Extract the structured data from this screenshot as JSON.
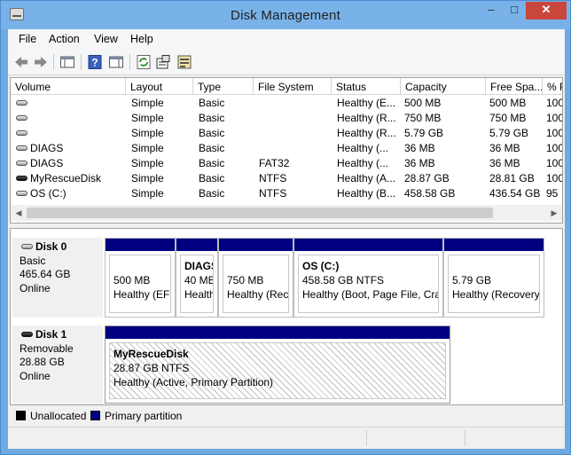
{
  "window": {
    "title": "Disk Management"
  },
  "menu": [
    "File",
    "Action",
    "View",
    "Help"
  ],
  "toolbar_icons": [
    "back-arrow-icon",
    "forward-arrow-icon",
    "console-tree-icon",
    "help-icon",
    "properties-panel-icon",
    "refresh-icon",
    "properties-icon",
    "export-list-icon"
  ],
  "volumes": {
    "columns": [
      "Volume",
      "Layout",
      "Type",
      "File System",
      "Status",
      "Capacity",
      "Free Spa...",
      "% F"
    ],
    "rows": [
      {
        "volume": "",
        "layout": "Simple",
        "type": "Basic",
        "fs": "",
        "status": "Healthy (E...",
        "capacity": "500 MB",
        "free": "500 MB",
        "pct": "100",
        "icon": "light"
      },
      {
        "volume": "",
        "layout": "Simple",
        "type": "Basic",
        "fs": "",
        "status": "Healthy (R...",
        "capacity": "750 MB",
        "free": "750 MB",
        "pct": "100",
        "icon": "light"
      },
      {
        "volume": "",
        "layout": "Simple",
        "type": "Basic",
        "fs": "",
        "status": "Healthy (R...",
        "capacity": "5.79 GB",
        "free": "5.79 GB",
        "pct": "100",
        "icon": "light"
      },
      {
        "volume": "DIAGS",
        "layout": "Simple",
        "type": "Basic",
        "fs": "",
        "status": "Healthy (...",
        "capacity": "36 MB",
        "free": "36 MB",
        "pct": "100",
        "icon": "light"
      },
      {
        "volume": "DIAGS",
        "layout": "Simple",
        "type": "Basic",
        "fs": "FAT32",
        "status": "Healthy (...",
        "capacity": "36 MB",
        "free": "36 MB",
        "pct": "100",
        "icon": "light"
      },
      {
        "volume": "MyRescueDisk",
        "layout": "Simple",
        "type": "Basic",
        "fs": "NTFS",
        "status": "Healthy (A...",
        "capacity": "28.87 GB",
        "free": "28.81 GB",
        "pct": "100",
        "icon": "dark"
      },
      {
        "volume": "OS (C:)",
        "layout": "Simple",
        "type": "Basic",
        "fs": "NTFS",
        "status": "Healthy (B...",
        "capacity": "458.58 GB",
        "free": "436.54 GB",
        "pct": "95",
        "icon": "light"
      }
    ]
  },
  "disks": [
    {
      "name": "Disk 0",
      "kind": "Basic",
      "size": "465.64 GB",
      "state": "Online",
      "icon": "light",
      "partitions": [
        {
          "title": "",
          "line1": "500 MB",
          "line2": "Healthy (EFI"
        },
        {
          "title": "DIAGS",
          "line1": "40 MB",
          "line2": "Health"
        },
        {
          "title": "",
          "line1": "750 MB",
          "line2": "Healthy (Reco"
        },
        {
          "title": "OS  (C:)",
          "line1": "458.58 GB NTFS",
          "line2": "Healthy (Boot, Page File, Cras"
        },
        {
          "title": "",
          "line1": "5.79 GB",
          "line2": "Healthy (Recovery"
        }
      ]
    },
    {
      "name": "Disk 1",
      "kind": "Removable",
      "size": "28.88 GB",
      "state": "Online",
      "icon": "dark",
      "partitions": [
        {
          "title": "MyRescueDisk",
          "line1": "28.87 GB NTFS",
          "line2": "Healthy (Active, Primary Partition)"
        }
      ]
    }
  ],
  "legend": [
    {
      "label": "Unallocated",
      "color": "#000000"
    },
    {
      "label": "Primary partition",
      "color": "#000080"
    }
  ]
}
